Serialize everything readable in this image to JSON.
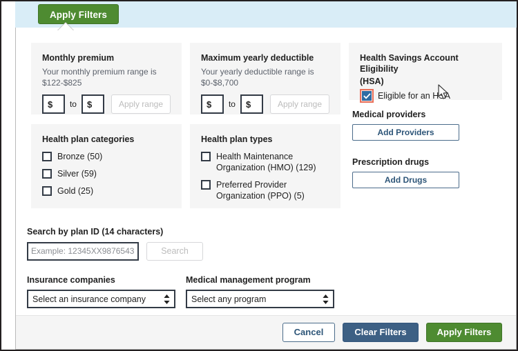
{
  "tab": {
    "label": "Apply Filters"
  },
  "monthly_premium": {
    "title": "Monthly premium",
    "subtitle_line1": "Your monthly premium range is",
    "subtitle_line2": "$122-$825",
    "min_value": "$",
    "max_value": "$",
    "to_label": "to",
    "apply_label": "Apply range"
  },
  "deductible": {
    "title": "Maximum yearly deductible",
    "subtitle_line1": "Your yearly deductible range is",
    "subtitle_line2": "$0-$8,700",
    "min_value": "$",
    "max_value": "$",
    "to_label": "to",
    "apply_label": "Apply range"
  },
  "hsa": {
    "title_line1": "Health Savings Account Eligibility",
    "title_line2": "(HSA)",
    "checkbox_label": "Eligible for an HSA",
    "checked": true,
    "focus_color": "#e8705a",
    "check_color": "#2e6ca4"
  },
  "plan_categories": {
    "title": "Health plan categories",
    "items": [
      {
        "label": "Bronze (50)",
        "checked": false
      },
      {
        "label": "Silver (59)",
        "checked": false
      },
      {
        "label": "Gold (25)",
        "checked": false
      }
    ]
  },
  "plan_types": {
    "title": "Health plan types",
    "items": [
      {
        "label": "Health Maintenance Organization (HMO) (129)",
        "checked": false
      },
      {
        "label": "Preferred Provider Organization (PPO) (5)",
        "checked": false
      }
    ]
  },
  "medical_providers": {
    "title": "Medical providers",
    "button_label": "Add Providers"
  },
  "prescription_drugs": {
    "title": "Prescription drugs",
    "button_label": "Add Drugs"
  },
  "plan_id_search": {
    "label": "Search by plan ID (14 characters)",
    "placeholder": "Example: 12345XX9876543",
    "value": "",
    "button_label": "Search"
  },
  "insurance_companies": {
    "label": "Insurance companies",
    "selected": "Select an insurance company"
  },
  "medical_management": {
    "label": "Medical management program",
    "selected": "Select any program"
  },
  "footer": {
    "cancel_label": "Cancel",
    "clear_label": "Clear Filters",
    "apply_label": "Apply Filters"
  },
  "colors": {
    "green": "#4e8b31",
    "steel_blue": "#3d6084",
    "link_blue": "#2d5578",
    "tab_strip_bg": "#d9edf7",
    "card_bg": "#f5f5f5"
  }
}
